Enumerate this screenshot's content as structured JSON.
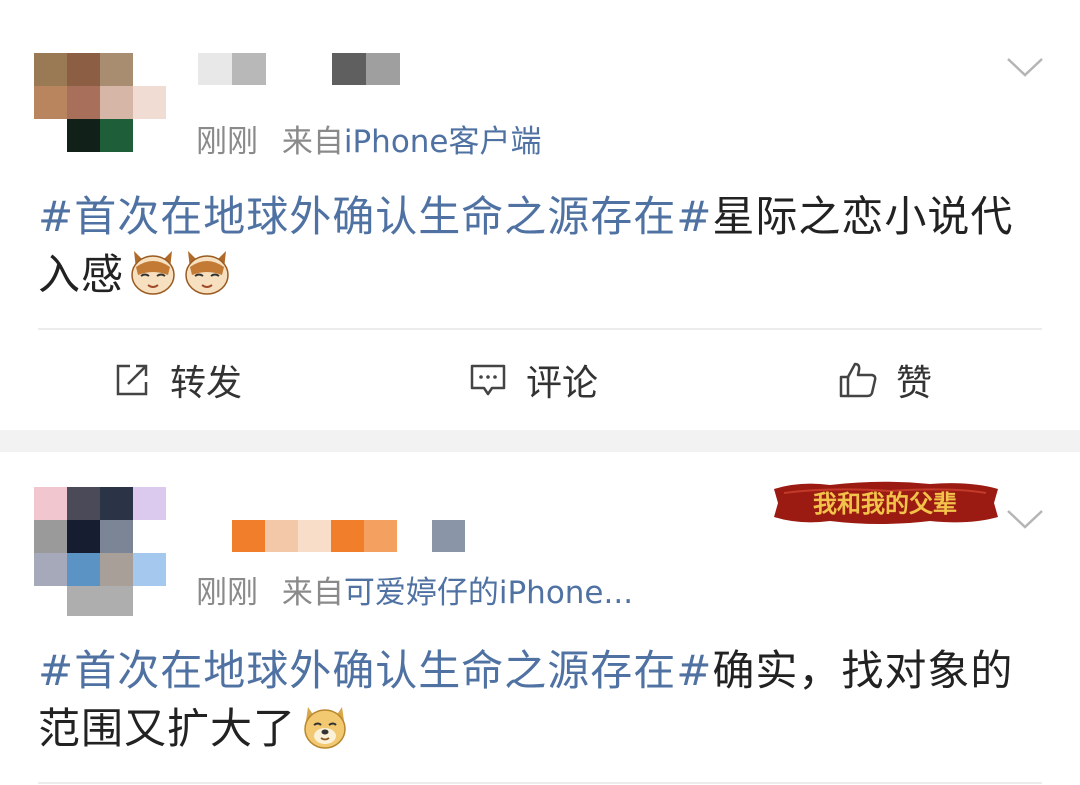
{
  "posts": [
    {
      "time": "刚刚",
      "from_prefix": "来自",
      "source": "iPhone客户端",
      "content": {
        "hashtag": "#首次在地球外确认生命之源存在#",
        "text": "星际之恋小说代入感"
      },
      "emojis": [
        "cat-face-icon",
        "cat-face-icon"
      ],
      "actions": {
        "repost_label": "转发",
        "comment_label": "评论",
        "like_label": "赞"
      }
    },
    {
      "time": "刚刚",
      "from_prefix": "来自",
      "source": "可爱婷仔的iPhone...",
      "badge_text": "我和我的父辈",
      "content": {
        "hashtag": "#首次在地球外确认生命之源存在#",
        "text": "确实，找对象的范围又扩大了"
      },
      "emojis": [
        "doge-face-icon"
      ]
    }
  ],
  "colors": {
    "hashtag": "#4f72a3",
    "meta_text": "#8a8a8a",
    "body_text": "#222222",
    "separator": "#f2f2f2",
    "badge_bg": "#9b1b12",
    "badge_text": "#f3c24a"
  }
}
